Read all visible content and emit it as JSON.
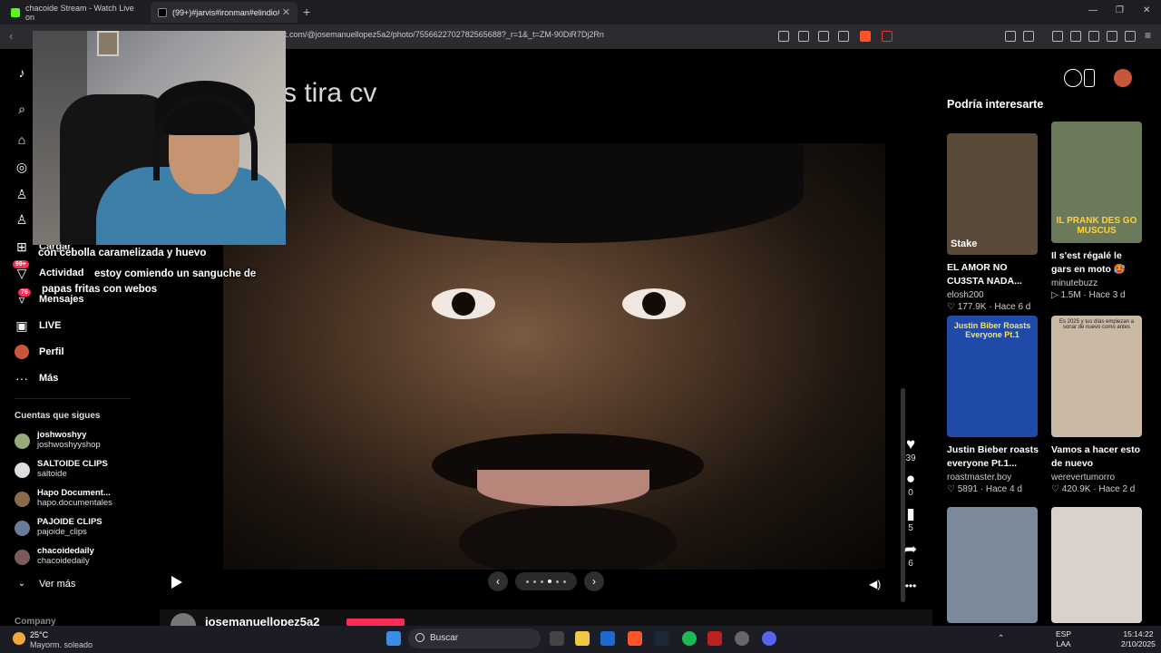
{
  "browser": {
    "tabs": [
      {
        "title": "chacoide Stream - Watch Live on",
        "color": "#53fc18"
      },
      {
        "title": "(99+)#jarvis#ironman#elindio#",
        "color": "#222"
      }
    ],
    "url": "k.com/@josemanuellopez5a2/photo/7556622702782565688?_r=1&_t=ZM-90DiR7Dj2Rn"
  },
  "nav": {
    "items": [
      {
        "label": "Cargar",
        "icon": "upload-icon"
      },
      {
        "label": "Actividad",
        "icon": "activity-icon",
        "badge": "99+"
      },
      {
        "label": "Mensajes",
        "icon": "messages-icon",
        "badge": "76"
      },
      {
        "label": "LIVE",
        "icon": "live-icon"
      },
      {
        "label": "Perfil",
        "icon": "profile-icon"
      },
      {
        "label": "Más",
        "icon": "more-icon"
      }
    ],
    "following_title": "Cuentas que sigues",
    "accounts": [
      {
        "name": "joshwoshyy",
        "handle": "joshwoshyyshop"
      },
      {
        "name": "SALTOIDE CLIPS",
        "handle": "saltoide"
      },
      {
        "name": "Hapo Document...",
        "handle": "hapo.documentales"
      },
      {
        "name": "PAJOIDE CLIPS",
        "handle": "pajoide_clips"
      },
      {
        "name": "chacoidedaily",
        "handle": "chacoidedaily"
      }
    ],
    "see_more": "Ver más",
    "company": "Company"
  },
  "chat": {
    "line1": "con cebolla caramelizada y huevo",
    "line2a": "estoy comiendo un sanguche de",
    "line2b": "papas fritas con webos"
  },
  "post": {
    "caption": "s tira cv",
    "author": "josemanuellopez5a2",
    "likes": "39",
    "comments": "0",
    "saves": "5",
    "shares": "6"
  },
  "right": {
    "title": "Podría interesarte",
    "cards": [
      {
        "title": "EL AMOR NO CU3STA NADA...",
        "user": "elosh200",
        "views": "177.9K",
        "age": "Hace 6 d",
        "thumb_text": "Stake",
        "bg": "#5a4a3a"
      },
      {
        "title": "Il s'est régalé le gars en moto 🥵 #humo...",
        "user": "minutebuzz",
        "views": "1.5M",
        "age": "Hace 3 d",
        "thumb_text": "IL PRANK DES GO MUSCUS",
        "bg": "#6b7a5a"
      },
      {
        "title": "Justin Bieber roasts everyone Pt.1...",
        "user": "roastmaster.boy",
        "views": "5891",
        "age": "Hace 4 d",
        "thumb_text": "Justin Biber Roasts Everyone Pt.1",
        "bg": "#1f4aa8"
      },
      {
        "title": "Vamos a hacer esto de nuevo",
        "user": "werevertumorro",
        "views": "420.9K",
        "age": "Hace 2 d",
        "thumb_text": "Es 2025 y tus días empiezan a sonar de nuevo como antes",
        "bg": "#c9b9a5"
      },
      {
        "title": "",
        "user": "",
        "views": "",
        "age": "",
        "thumb_text": "",
        "bg": "#7a8a9a"
      },
      {
        "title": "",
        "user": "",
        "views": "",
        "age": "",
        "thumb_text": "",
        "bg": "#d9d2cc"
      }
    ]
  },
  "taskbar": {
    "temp": "25°C",
    "weather": "Mayorm. soleado",
    "search": "Buscar",
    "lang1": "ESP",
    "lang2": "LAA",
    "time": "15:14:22",
    "date": "2/10/2025"
  }
}
